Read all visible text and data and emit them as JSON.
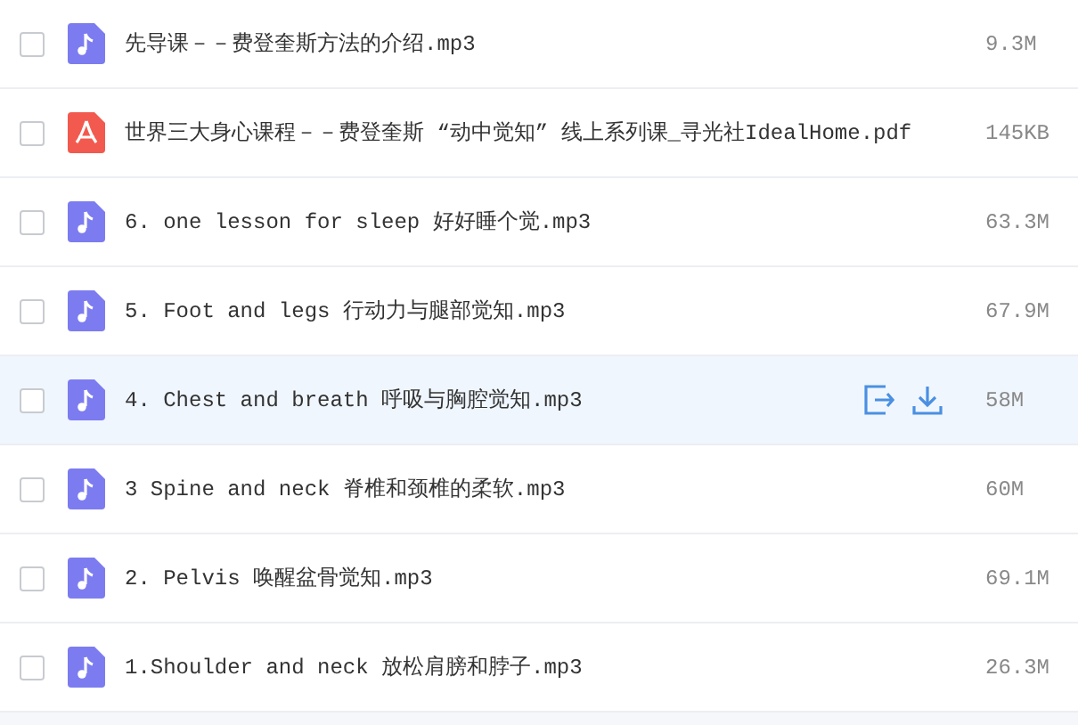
{
  "files": [
    {
      "kind": "audio",
      "name": "先导课－－费登奎斯方法的介绍.mp3",
      "size": "9.3M",
      "checked": false,
      "highlighted": false
    },
    {
      "kind": "pdf",
      "name": "世界三大身心课程－－费登奎斯 “动中觉知” 线上系列课_寻光社IdealHome.pdf",
      "size": "145KB",
      "checked": false,
      "highlighted": false
    },
    {
      "kind": "audio",
      "name": "6. one lesson for sleep 好好睡个觉.mp3",
      "size": "63.3M",
      "checked": false,
      "highlighted": false
    },
    {
      "kind": "audio",
      "name": "5. Foot and legs 行动力与腿部觉知.mp3",
      "size": "67.9M",
      "checked": false,
      "highlighted": false
    },
    {
      "kind": "audio",
      "name": "4. Chest and breath 呼吸与胸腔觉知.mp3",
      "size": "58M",
      "checked": false,
      "highlighted": true
    },
    {
      "kind": "audio",
      "name": "3 Spine and neck 脊椎和颈椎的柔软.mp3",
      "size": "60M",
      "checked": false,
      "highlighted": false
    },
    {
      "kind": "audio",
      "name": "2. Pelvis 唤醒盆骨觉知.mp3",
      "size": "69.1M",
      "checked": false,
      "highlighted": false
    },
    {
      "kind": "audio",
      "name": "1.Shoulder and neck 放松肩膀和脖子.mp3",
      "size": "26.3M",
      "checked": false,
      "highlighted": false
    }
  ]
}
